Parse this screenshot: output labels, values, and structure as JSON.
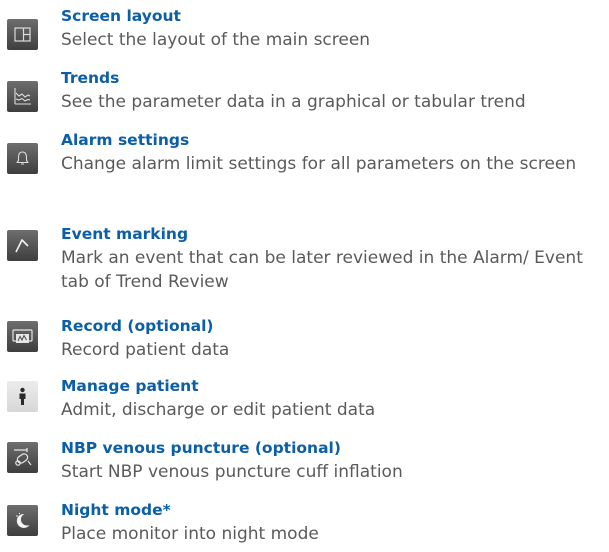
{
  "features": [
    {
      "title": "Screen layout",
      "description": "Select the layout of the main screen",
      "icon": "screen-layout-icon"
    },
    {
      "title": "Trends",
      "description": "See the parameter data in a graphical or tabular trend",
      "icon": "trends-icon"
    },
    {
      "title": "Alarm settings",
      "description": "Change alarm limit settings for all parameters on the screen",
      "icon": "bell-icon"
    },
    {
      "title": "Event marking",
      "description": "Mark an event that can be later reviewed in the Alarm/ Event tab of Trend Review",
      "icon": "event-marker-icon"
    },
    {
      "title": "Record (optional)",
      "description": "Record patient data",
      "icon": "recorder-icon"
    },
    {
      "title": "Manage patient",
      "description": "Admit, discharge or edit patient data",
      "icon": "patient-icon"
    },
    {
      "title": "NBP venous puncture (optional)",
      "description": "Start NBP venous puncture cuff inflation",
      "icon": "venous-puncture-icon"
    },
    {
      "title": "Night mode*",
      "description": "Place monitor into night mode",
      "icon": "night-mode-icon"
    }
  ]
}
